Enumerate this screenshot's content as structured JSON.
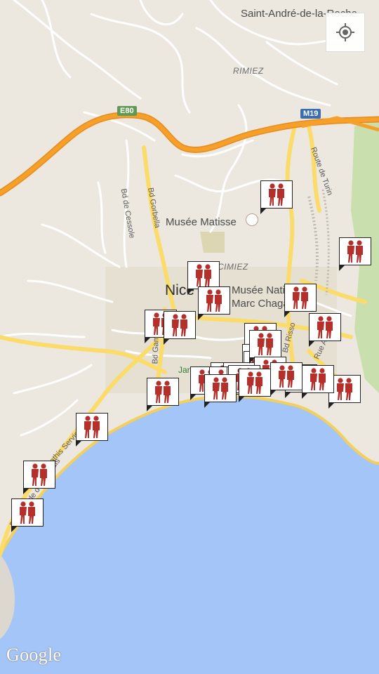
{
  "map": {
    "place_labels": {
      "saint_andre": "Saint-André-de-la-Roche",
      "rimiez": "RIMIEZ",
      "cimiez": "CIMIEZ",
      "musee_matisse": "Musée Matisse",
      "nice": "Nice",
      "musee_chagall": "Musée National\nMarc Chagall",
      "jardin": "Jardin Albert I"
    },
    "road_labels": {
      "e80": "E80",
      "m19": "M19",
      "bd_gorbella": "Bd Gorbella",
      "bd_cessole": "Bd de Cessole",
      "route_turin": "Route de Turin",
      "bd_gambetta": "Bd Gambetta",
      "bd_risso": "Bd Risso",
      "rue_arson": "Rue Arson",
      "promenade": "Promenade des Anglais",
      "mathis": "Mathis Service Rd"
    },
    "attribution": "Google",
    "icons": {
      "locate": "my-location-icon",
      "poi": "museum-icon",
      "marker": "couple-icon"
    },
    "colors": {
      "land": "#ece8df",
      "water": "#a4c5f8",
      "highway": "#f4a02a",
      "major_road": "#fbdc6a",
      "minor_road": "#ffffff",
      "marker_figure": "#b5302b"
    },
    "marker_count": 30
  }
}
